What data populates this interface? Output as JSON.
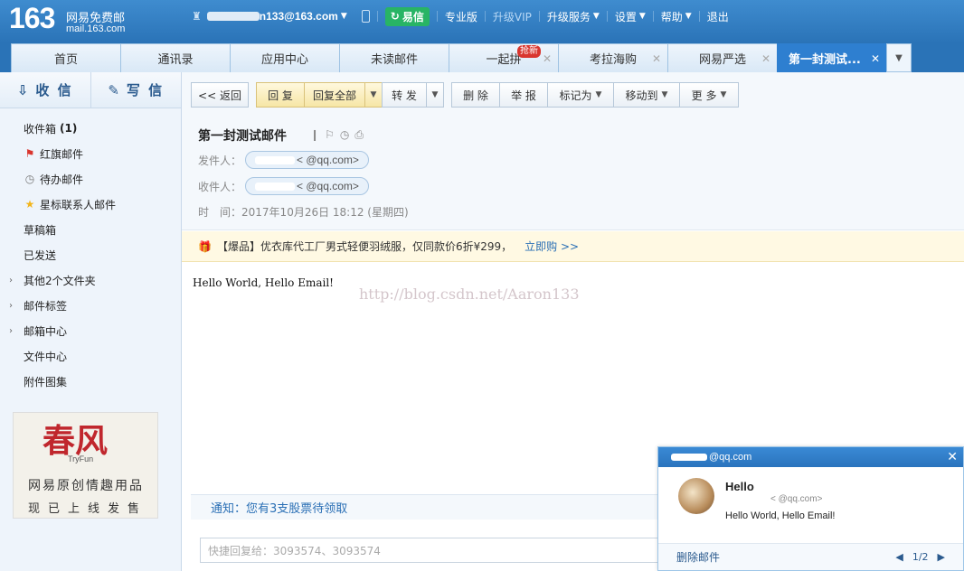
{
  "header": {
    "logo_num": "163",
    "logo_cn": "网易免费邮",
    "logo_domain": "mail.163.com",
    "user_email": "n133@163.com",
    "yixin": "易信",
    "links": [
      "专业版",
      "升级VIP",
      "升级服务",
      "设置",
      "帮助",
      "退出"
    ]
  },
  "tabs": [
    "首页",
    "通讯录",
    "应用中心",
    "未读邮件",
    "一起拼",
    "考拉海购",
    "网易严选",
    "第一封测试..."
  ],
  "hot_badge": "抢新",
  "sidebar": {
    "receive": "收 信",
    "write": "写 信",
    "items": [
      {
        "label": "收件箱",
        "count": "(1)"
      },
      {
        "label": "红旗邮件"
      },
      {
        "label": "待办邮件"
      },
      {
        "label": "星标联系人邮件"
      },
      {
        "label": "草稿箱"
      },
      {
        "label": "已发送"
      },
      {
        "label": "其他2个文件夹"
      },
      {
        "label": "邮件标签"
      },
      {
        "label": "邮箱中心"
      },
      {
        "label": "文件中心"
      },
      {
        "label": "附件图集"
      }
    ],
    "ad": {
      "title": "春风",
      "sub": "TryFun",
      "line1": "网易原创情趣用品",
      "line2": "现已上线发售"
    }
  },
  "toolbar": {
    "back": "<< 返回",
    "reply": "回 复",
    "reply_all": "回复全部",
    "forward": "转 发",
    "delete": "删 除",
    "report": "举 报",
    "mark": "标记为",
    "move": "移动到",
    "more": "更 多"
  },
  "mail": {
    "subject": "第一封测试邮件",
    "from_label": "发件人：",
    "from_addr": "<      @qq.com>",
    "to_label": "收件人：",
    "to_addr": "<      @qq.com>",
    "time_label": "时　间：",
    "time": "2017年10月26日 18:12 (星期四)",
    "body": "Hello World, Hello Email!",
    "watermark": "http://blog.csdn.net/Aaron133"
  },
  "promo": {
    "text": "【爆品】优衣库代工厂男式轻便羽绒服，仅同款价6折¥299，",
    "link": "立即购 >>"
  },
  "notice": "通知：您有3支股票待领取",
  "quick_reply_placeholder": "快捷回复给：3093574、3093574",
  "popup": {
    "head": "@qq.com",
    "from": "Hello",
    "addr": "<        @qq.com>",
    "body": "Hello World, Hello Email!",
    "delete": "删除邮件",
    "page": "1/2"
  }
}
